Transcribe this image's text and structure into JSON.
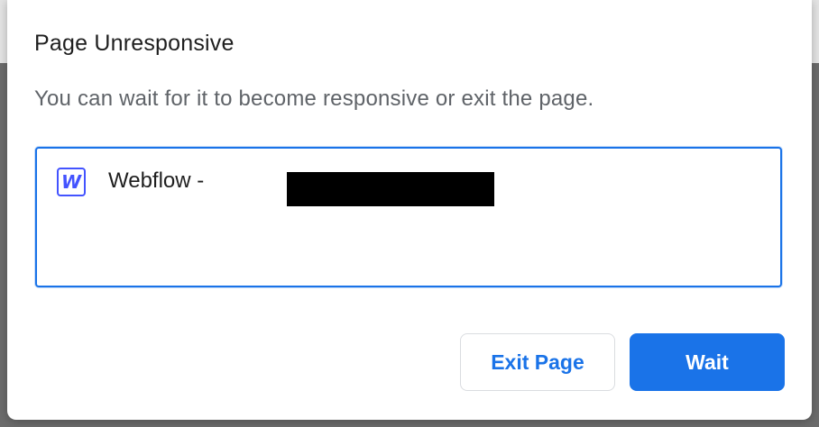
{
  "dialog": {
    "title": "Page Unresponsive",
    "message": "You can wait for it to become responsive or exit the page.",
    "tabs": [
      {
        "favicon_letter": "W",
        "favicon_icon": "webflow-logo-icon",
        "title_prefix": "Webflow -",
        "title_redacted": true
      }
    ],
    "buttons": {
      "exit_label": "Exit Page",
      "wait_label": "Wait"
    }
  },
  "colors": {
    "accent": "#1a73e8",
    "webflow_brand": "#4353ff",
    "backdrop": "#6b6b6b"
  }
}
